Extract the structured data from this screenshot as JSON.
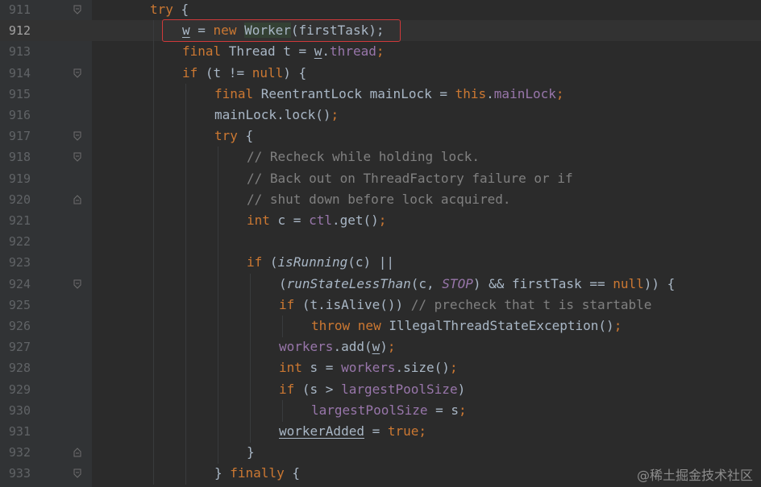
{
  "editor": {
    "watermark": "@稀土掘金技术社区",
    "highlight_color": "#d0393a",
    "lines": [
      {
        "num": "911",
        "fold": "open",
        "indent": 1,
        "tokens": [
          [
            "kw",
            "try"
          ],
          [
            "p",
            " {"
          ]
        ]
      },
      {
        "num": "912",
        "fold": "",
        "indent": 2,
        "current": true,
        "tokens": [
          [
            "ul",
            "w"
          ],
          [
            "p",
            " = "
          ],
          [
            "kw",
            "new "
          ],
          [
            "cls",
            "Worker"
          ],
          [
            "p",
            "(firstTask);"
          ]
        ]
      },
      {
        "num": "913",
        "fold": "",
        "indent": 2,
        "tokens": [
          [
            "kw",
            "final "
          ],
          [
            "p",
            "Thread t = "
          ],
          [
            "ul",
            "w"
          ],
          [
            "p",
            "."
          ],
          [
            "field",
            "thread"
          ],
          [
            "kw",
            ";"
          ]
        ]
      },
      {
        "num": "914",
        "fold": "open",
        "indent": 2,
        "tokens": [
          [
            "kw",
            "if "
          ],
          [
            "p",
            "(t != "
          ],
          [
            "kw",
            "null"
          ],
          [
            "p",
            ") {"
          ]
        ]
      },
      {
        "num": "915",
        "fold": "",
        "indent": 3,
        "tokens": [
          [
            "kw",
            "final "
          ],
          [
            "p",
            "ReentrantLock mainLock = "
          ],
          [
            "kw",
            "this"
          ],
          [
            "p",
            "."
          ],
          [
            "field",
            "mainLock"
          ],
          [
            "kw",
            ";"
          ]
        ]
      },
      {
        "num": "916",
        "fold": "",
        "indent": 3,
        "tokens": [
          [
            "p",
            "mainLock.lock()"
          ],
          [
            "kw",
            ";"
          ]
        ]
      },
      {
        "num": "917",
        "fold": "open",
        "indent": 3,
        "tokens": [
          [
            "kw",
            "try "
          ],
          [
            "p",
            "{"
          ]
        ]
      },
      {
        "num": "918",
        "fold": "open",
        "indent": 4,
        "tokens": [
          [
            "cmt",
            "// Recheck while holding lock."
          ]
        ]
      },
      {
        "num": "919",
        "fold": "",
        "indent": 4,
        "tokens": [
          [
            "cmt",
            "// Back out on ThreadFactory failure or if"
          ]
        ]
      },
      {
        "num": "920",
        "fold": "close",
        "indent": 4,
        "tokens": [
          [
            "cmt",
            "// shut down before lock acquired."
          ]
        ]
      },
      {
        "num": "921",
        "fold": "",
        "indent": 4,
        "tokens": [
          [
            "kw",
            "int "
          ],
          [
            "p",
            "c = "
          ],
          [
            "field",
            "ctl"
          ],
          [
            "p",
            ".get()"
          ],
          [
            "kw",
            ";"
          ]
        ]
      },
      {
        "num": "922",
        "fold": "",
        "indent": 4,
        "tokens": []
      },
      {
        "num": "923",
        "fold": "",
        "indent": 4,
        "tokens": [
          [
            "kw",
            "if "
          ],
          [
            "p",
            "("
          ],
          [
            "it",
            "isRunning"
          ],
          [
            "p",
            "(c) ||"
          ]
        ]
      },
      {
        "num": "924",
        "fold": "open",
        "indent": 5,
        "tokens": [
          [
            "p",
            "("
          ],
          [
            "it",
            "runStateLessThan"
          ],
          [
            "p",
            "(c, "
          ],
          [
            "const",
            "STOP"
          ],
          [
            "p",
            ") && firstTask == "
          ],
          [
            "kw",
            "null"
          ],
          [
            "p",
            ")) {"
          ]
        ]
      },
      {
        "num": "925",
        "fold": "",
        "indent": 5,
        "tokens": [
          [
            "kw",
            "if "
          ],
          [
            "p",
            "(t.isAlive()) "
          ],
          [
            "cmt",
            "// precheck that t is startable"
          ]
        ]
      },
      {
        "num": "926",
        "fold": "",
        "indent": 6,
        "tokens": [
          [
            "kw",
            "throw new "
          ],
          [
            "p",
            "IllegalThreadStateException()"
          ],
          [
            "kw",
            ";"
          ]
        ]
      },
      {
        "num": "927",
        "fold": "",
        "indent": 5,
        "tokens": [
          [
            "field",
            "workers"
          ],
          [
            "p",
            ".add("
          ],
          [
            "ul",
            "w"
          ],
          [
            "p",
            ")"
          ],
          [
            "kw",
            ";"
          ]
        ]
      },
      {
        "num": "928",
        "fold": "",
        "indent": 5,
        "tokens": [
          [
            "kw",
            "int "
          ],
          [
            "p",
            "s = "
          ],
          [
            "field",
            "workers"
          ],
          [
            "p",
            ".size()"
          ],
          [
            "kw",
            ";"
          ]
        ]
      },
      {
        "num": "929",
        "fold": "",
        "indent": 5,
        "tokens": [
          [
            "kw",
            "if "
          ],
          [
            "p",
            "(s > "
          ],
          [
            "field",
            "largestPoolSize"
          ],
          [
            "p",
            ")"
          ]
        ]
      },
      {
        "num": "930",
        "fold": "",
        "indent": 6,
        "tokens": [
          [
            "field",
            "largestPoolSize"
          ],
          [
            "p",
            " = s"
          ],
          [
            "kw",
            ";"
          ]
        ]
      },
      {
        "num": "931",
        "fold": "",
        "indent": 5,
        "tokens": [
          [
            "ul",
            "workerAdded"
          ],
          [
            "p",
            " = "
          ],
          [
            "kw",
            "true"
          ],
          [
            "kw",
            ";"
          ]
        ]
      },
      {
        "num": "932",
        "fold": "close",
        "indent": 4,
        "tokens": [
          [
            "p",
            "}"
          ]
        ]
      },
      {
        "num": "933",
        "fold": "open",
        "indent": 3,
        "tokens": [
          [
            "p",
            "} "
          ],
          [
            "kw",
            "finally "
          ],
          [
            "p",
            "{"
          ]
        ]
      }
    ]
  }
}
